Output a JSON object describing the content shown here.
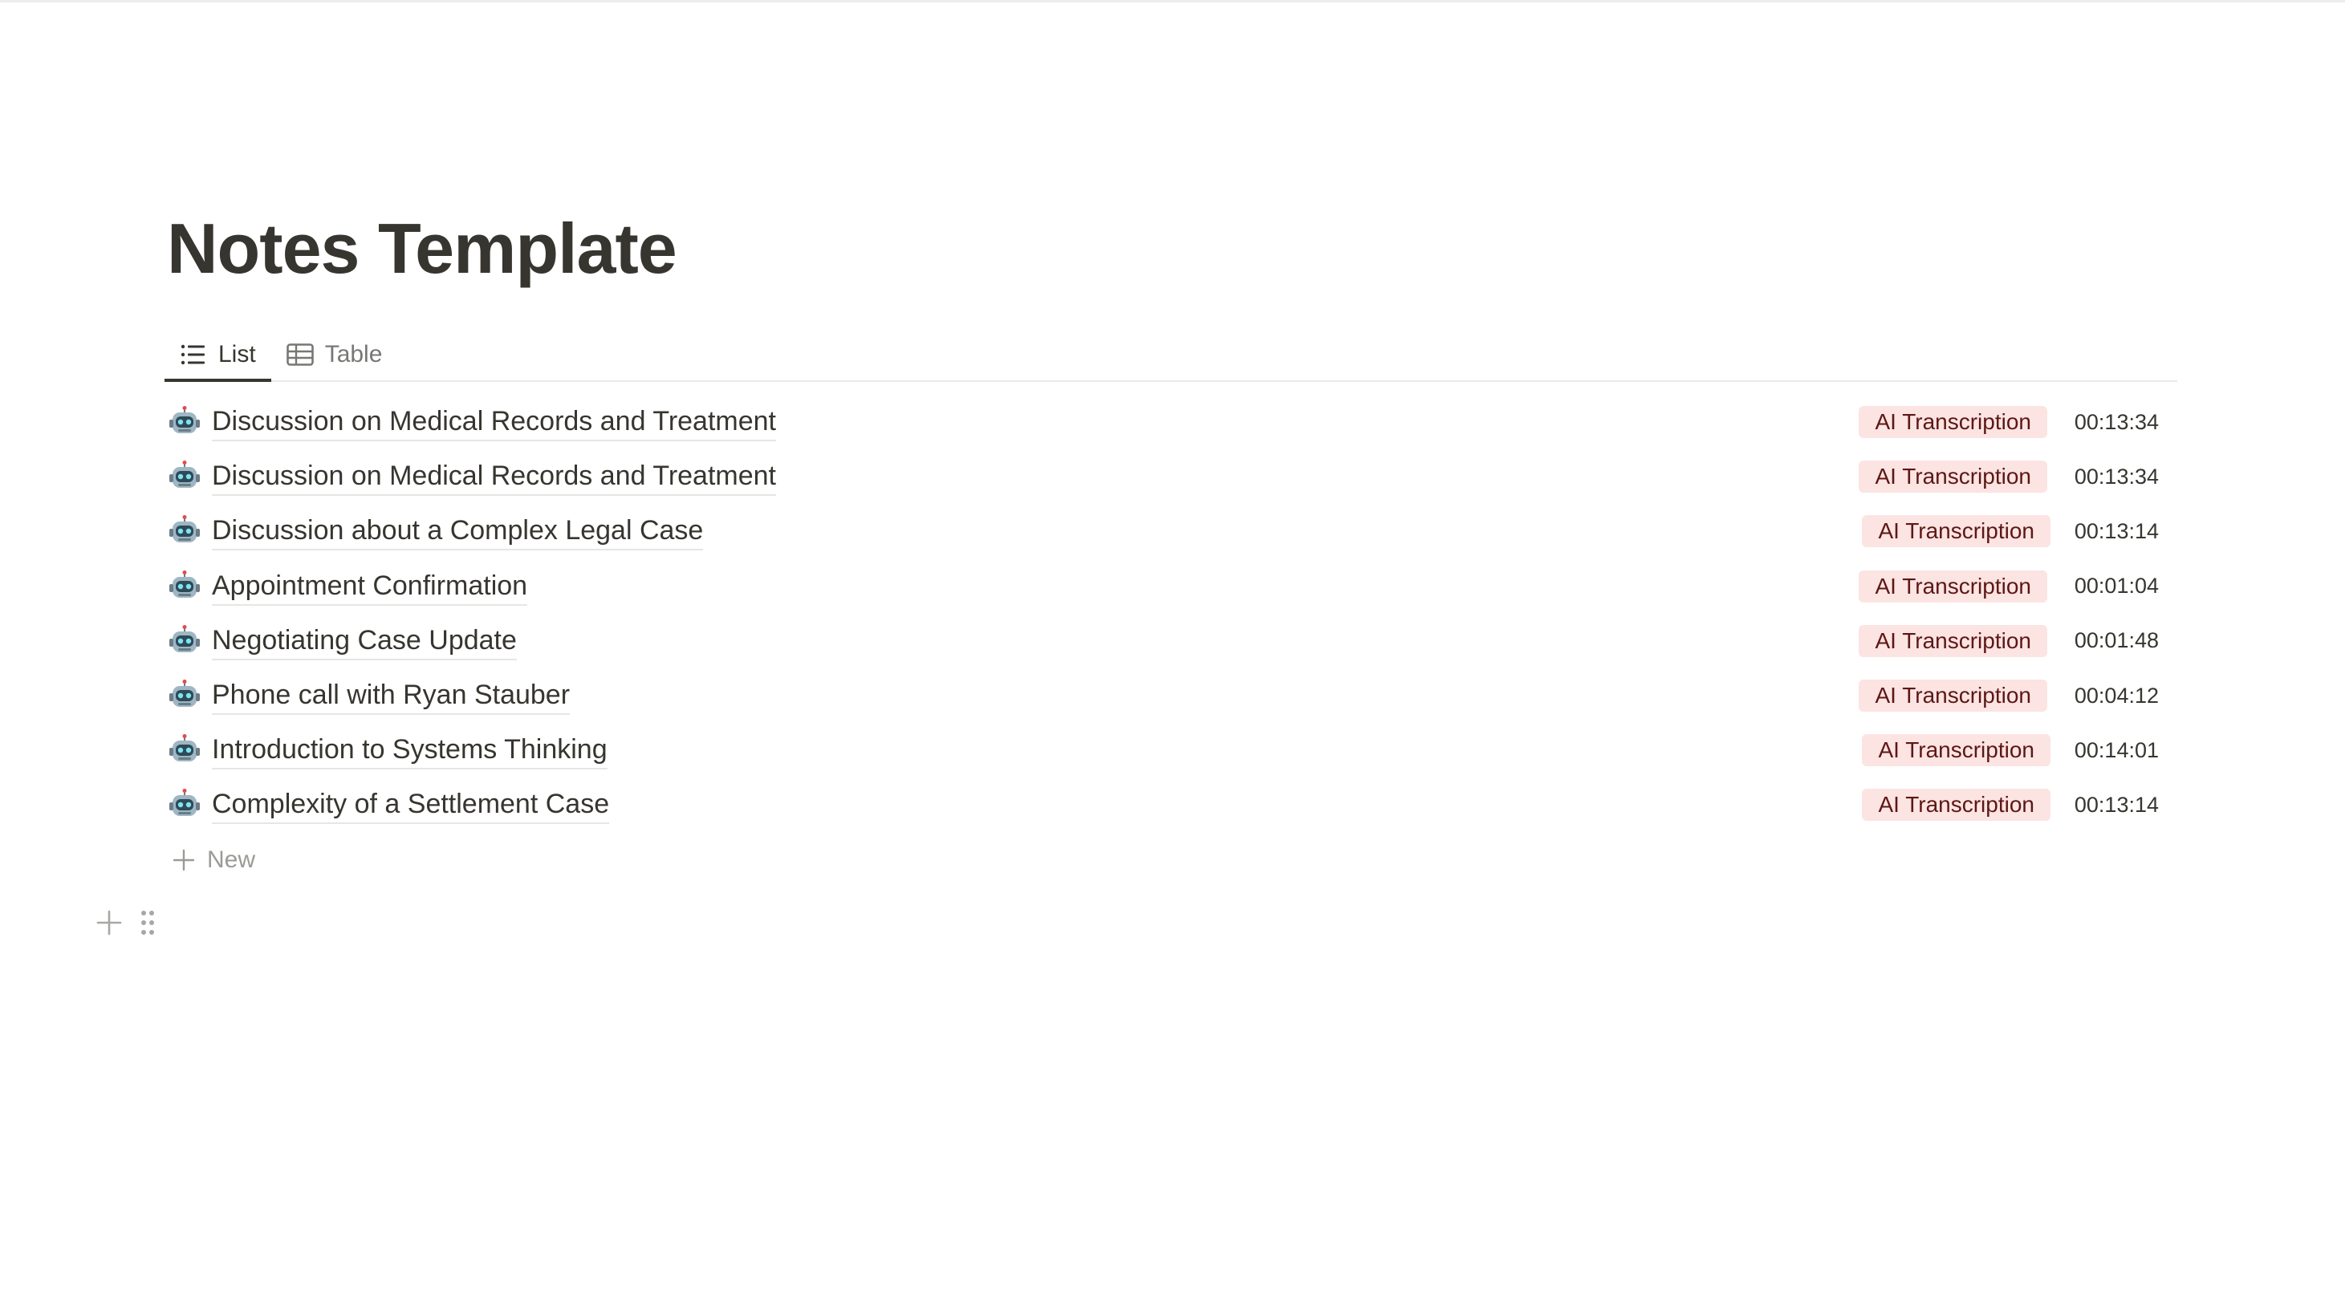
{
  "page": {
    "title": "Notes Template"
  },
  "views": {
    "tabs": [
      {
        "label": "List",
        "icon": "list-icon",
        "active": true
      },
      {
        "label": "Table",
        "icon": "table-icon",
        "active": false
      }
    ]
  },
  "notes": {
    "items": [
      {
        "icon": "robot-icon",
        "title": "Discussion on Medical Records and Treatment",
        "tag": "AI Transcription",
        "duration": "00:13:34"
      },
      {
        "icon": "robot-icon",
        "title": "Discussion on Medical Records and Treatment",
        "tag": "AI Transcription",
        "duration": "00:13:34"
      },
      {
        "icon": "robot-icon",
        "title": "Discussion about a Complex Legal Case",
        "tag": "AI Transcription",
        "duration": "00:13:14"
      },
      {
        "icon": "robot-icon",
        "title": "Appointment Confirmation",
        "tag": "AI Transcription",
        "duration": "00:01:04"
      },
      {
        "icon": "robot-icon",
        "title": "Negotiating Case Update",
        "tag": "AI Transcription",
        "duration": "00:01:48"
      },
      {
        "icon": "robot-icon",
        "title": "Phone call with Ryan Stauber",
        "tag": "AI Transcription",
        "duration": "00:04:12"
      },
      {
        "icon": "robot-icon",
        "title": "Introduction to Systems Thinking",
        "tag": "AI Transcription",
        "duration": "00:14:01"
      },
      {
        "icon": "robot-icon",
        "title": "Complexity of a Settlement Case",
        "tag": "AI Transcription",
        "duration": "00:13:14"
      }
    ],
    "new_label": "New"
  },
  "colors": {
    "tag_background": "#fbe4e2",
    "tag_text": "#5d1715",
    "text": "#37352f",
    "muted": "#9b9a97"
  }
}
